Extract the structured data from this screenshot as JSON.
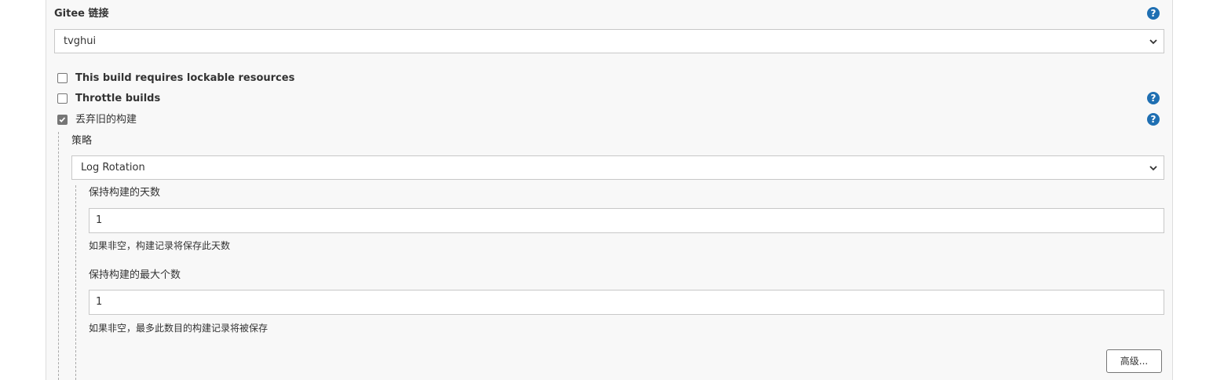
{
  "gitee": {
    "label": "Gitee 链接",
    "selected": "tvghui"
  },
  "options": [
    {
      "label": "This build requires lockable resources",
      "checked": false
    },
    {
      "label": "Throttle builds",
      "checked": false
    },
    {
      "label": "丢弃旧的构建",
      "checked": true
    }
  ],
  "strategy": {
    "label": "策略",
    "selected": "Log Rotation"
  },
  "days_to_keep": {
    "label": "保持构建的天数",
    "value": "1",
    "hint": "如果非空，构建记录将保存此天数"
  },
  "num_to_keep": {
    "label": "保持构建的最大个数",
    "value": "1",
    "hint": "如果非空，最多此数目的构建记录将被保存"
  },
  "advanced_button": "高级...",
  "help_icon_glyph": "?",
  "icons": {
    "help": "help-icon",
    "chevron": "chevron-down-icon",
    "check": "checkmark-icon"
  },
  "colors": {
    "help_blue": "#1f6fb2",
    "panel_bg": "#f8f8f8"
  }
}
